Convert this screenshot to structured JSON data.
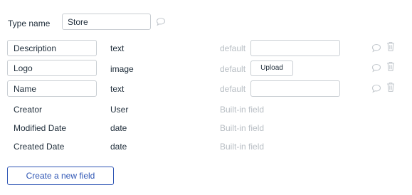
{
  "type_name": {
    "label": "Type name",
    "value": "Store"
  },
  "fields": [
    {
      "name": "Description",
      "type": "text",
      "default_label": "default",
      "default_kind": "input",
      "default_value": ""
    },
    {
      "name": "Logo",
      "type": "image",
      "default_label": "default",
      "default_kind": "upload",
      "upload_label": "Upload"
    },
    {
      "name": "Name",
      "type": "text",
      "default_label": "default",
      "default_kind": "input",
      "default_value": ""
    }
  ],
  "builtin_fields": [
    {
      "name": "Creator",
      "type": "User",
      "note": "Built-in field"
    },
    {
      "name": "Modified Date",
      "type": "date",
      "note": "Built-in field"
    },
    {
      "name": "Created Date",
      "type": "date",
      "note": "Built-in field"
    }
  ],
  "create_button_label": "Create a new field",
  "colors": {
    "accent": "#2f56b5",
    "muted_text": "#b8bec4",
    "border": "#c9ced3",
    "icon": "#c6cbd0"
  },
  "icons": {
    "comment": "comment-icon",
    "delete": "trash-icon"
  }
}
